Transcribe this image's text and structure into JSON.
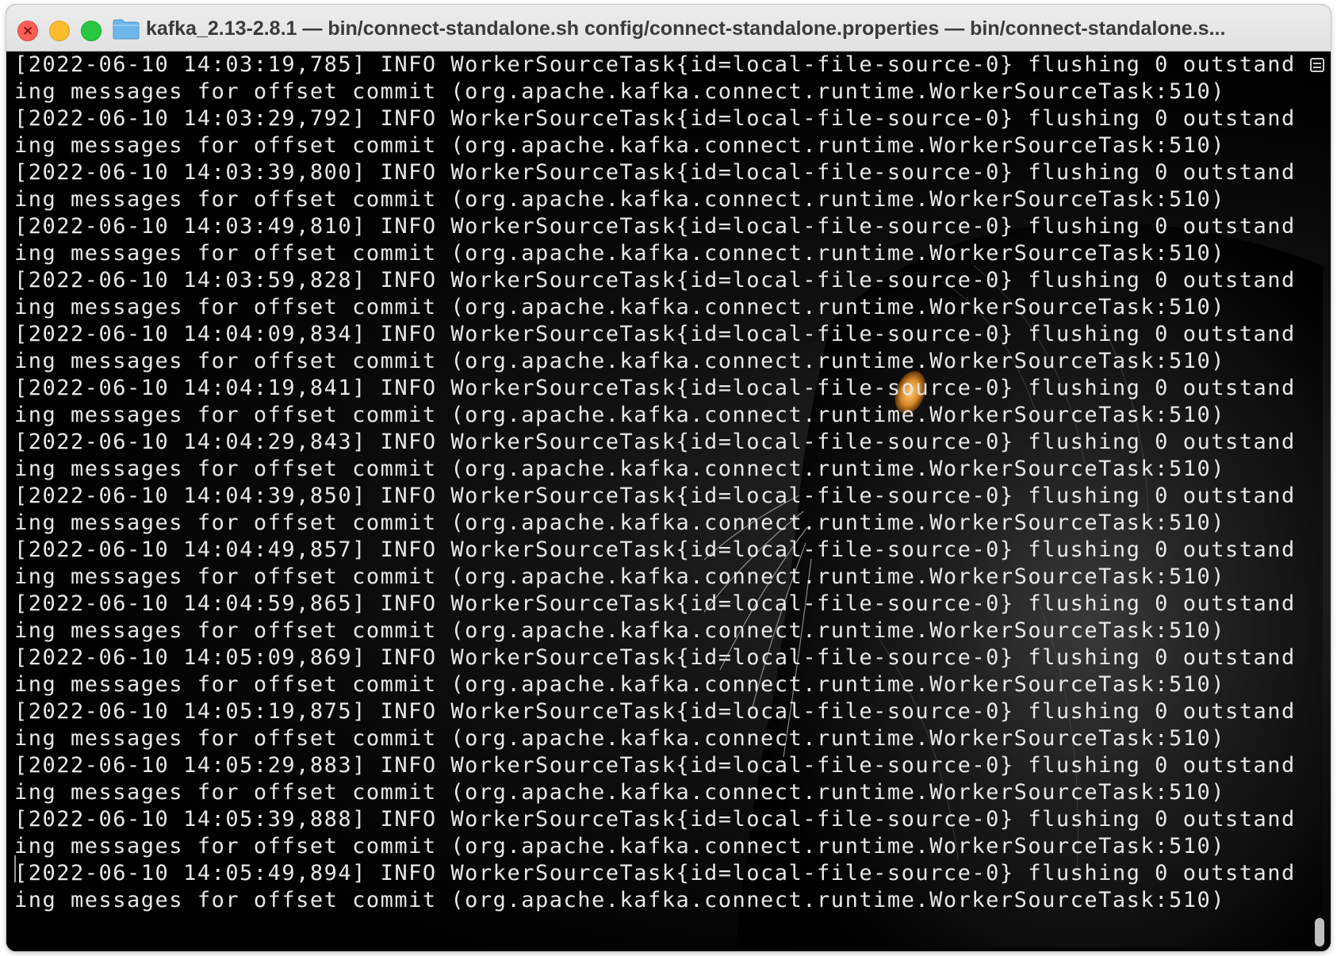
{
  "window": {
    "title": "kafka_2.13-2.8.1 — bin/connect-standalone.sh config/connect-standalone.properties   — bin/connect-standalone.s..."
  },
  "colors": {
    "close": "#fe5f57",
    "minimize": "#febc2e",
    "maximize": "#28c840",
    "terminal_bg": "#000000",
    "terminal_text": "#e8e8e8"
  },
  "icons": {
    "folder": "folder-icon",
    "close": "close-icon"
  },
  "log_lines": [
    "[2022-06-10 14:03:19,785] INFO WorkerSourceTask{id=local-file-source-0} flushing 0 outstanding messages for offset commit (org.apache.kafka.connect.runtime.WorkerSourceTask:510)",
    "[2022-06-10 14:03:29,792] INFO WorkerSourceTask{id=local-file-source-0} flushing 0 outstanding messages for offset commit (org.apache.kafka.connect.runtime.WorkerSourceTask:510)",
    "[2022-06-10 14:03:39,800] INFO WorkerSourceTask{id=local-file-source-0} flushing 0 outstanding messages for offset commit (org.apache.kafka.connect.runtime.WorkerSourceTask:510)",
    "[2022-06-10 14:03:49,810] INFO WorkerSourceTask{id=local-file-source-0} flushing 0 outstanding messages for offset commit (org.apache.kafka.connect.runtime.WorkerSourceTask:510)",
    "[2022-06-10 14:03:59,828] INFO WorkerSourceTask{id=local-file-source-0} flushing 0 outstanding messages for offset commit (org.apache.kafka.connect.runtime.WorkerSourceTask:510)",
    "[2022-06-10 14:04:09,834] INFO WorkerSourceTask{id=local-file-source-0} flushing 0 outstanding messages for offset commit (org.apache.kafka.connect.runtime.WorkerSourceTask:510)",
    "[2022-06-10 14:04:19,841] INFO WorkerSourceTask{id=local-file-source-0} flushing 0 outstanding messages for offset commit (org.apache.kafka.connect.runtime.WorkerSourceTask:510)",
    "[2022-06-10 14:04:29,843] INFO WorkerSourceTask{id=local-file-source-0} flushing 0 outstanding messages for offset commit (org.apache.kafka.connect.runtime.WorkerSourceTask:510)",
    "[2022-06-10 14:04:39,850] INFO WorkerSourceTask{id=local-file-source-0} flushing 0 outstanding messages for offset commit (org.apache.kafka.connect.runtime.WorkerSourceTask:510)",
    "[2022-06-10 14:04:49,857] INFO WorkerSourceTask{id=local-file-source-0} flushing 0 outstanding messages for offset commit (org.apache.kafka.connect.runtime.WorkerSourceTask:510)",
    "[2022-06-10 14:04:59,865] INFO WorkerSourceTask{id=local-file-source-0} flushing 0 outstanding messages for offset commit (org.apache.kafka.connect.runtime.WorkerSourceTask:510)",
    "[2022-06-10 14:05:09,869] INFO WorkerSourceTask{id=local-file-source-0} flushing 0 outstanding messages for offset commit (org.apache.kafka.connect.runtime.WorkerSourceTask:510)",
    "[2022-06-10 14:05:19,875] INFO WorkerSourceTask{id=local-file-source-0} flushing 0 outstanding messages for offset commit (org.apache.kafka.connect.runtime.WorkerSourceTask:510)",
    "[2022-06-10 14:05:29,883] INFO WorkerSourceTask{id=local-file-source-0} flushing 0 outstanding messages for offset commit (org.apache.kafka.connect.runtime.WorkerSourceTask:510)",
    "[2022-06-10 14:05:39,888] INFO WorkerSourceTask{id=local-file-source-0} flushing 0 outstanding messages for offset commit (org.apache.kafka.connect.runtime.WorkerSourceTask:510)",
    "[2022-06-10 14:05:49,894] INFO WorkerSourceTask{id=local-file-source-0} flushing 0 outstanding messages for offset commit (org.apache.kafka.connect.runtime.WorkerSourceTask:510)"
  ]
}
